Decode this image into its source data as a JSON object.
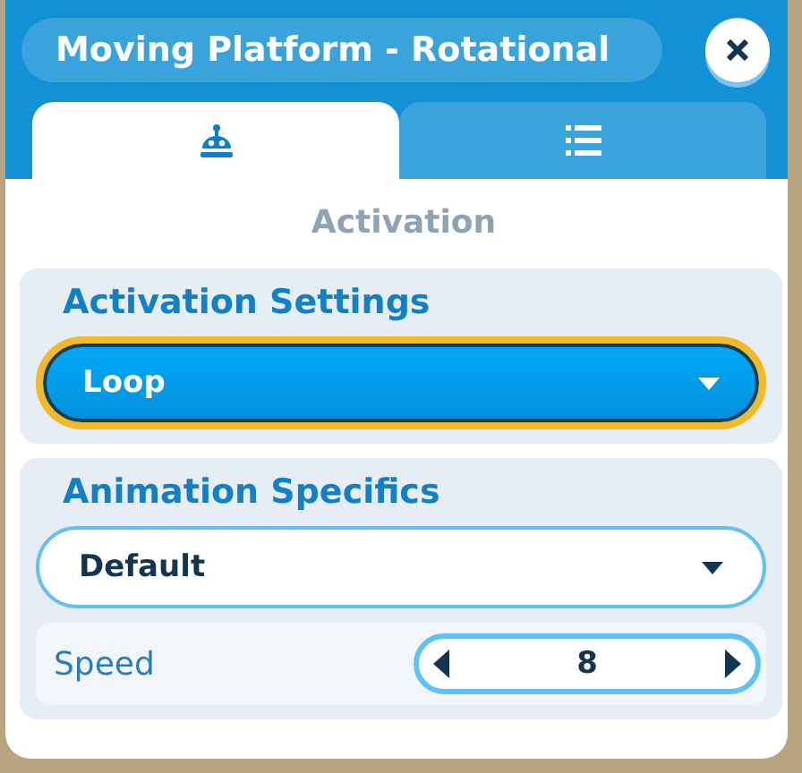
{
  "window": {
    "title": "Moving Platform - Rotational"
  },
  "tabs": [
    {
      "kind": "robot",
      "selected": true
    },
    {
      "kind": "list",
      "selected": false
    }
  ],
  "page_heading": "Activation",
  "sections": [
    {
      "title": "Activation Settings",
      "controls": [
        {
          "kind": "dropdown",
          "value": "Loop",
          "focused": true
        }
      ]
    },
    {
      "title": "Animation Specifics",
      "controls": [
        {
          "kind": "dropdown",
          "value": "Default",
          "focused": false
        },
        {
          "kind": "stepper",
          "label": "Speed",
          "value": "8"
        }
      ]
    }
  ]
}
